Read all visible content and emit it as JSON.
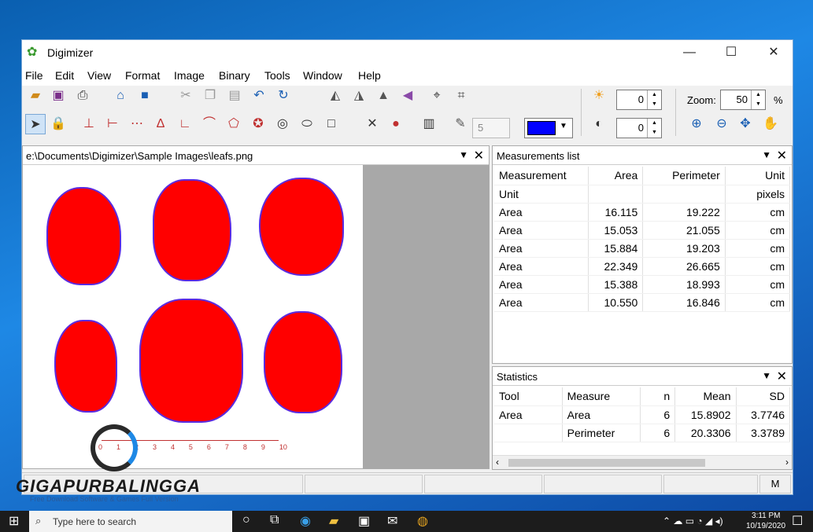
{
  "window": {
    "title": "Digimizer",
    "minimize": "—",
    "maximize": "☐",
    "close": "✕"
  },
  "menu": [
    "File",
    "Edit",
    "View",
    "Format",
    "Image",
    "Binary",
    "Tools",
    "Window",
    "Help"
  ],
  "toolbar": {
    "brightness_value": "0",
    "contrast_value": "0",
    "zoom_label": "Zoom:",
    "zoom_value": "50",
    "zoom_unit": "%",
    "point_value": "5",
    "color_swatch": "#0000ff",
    "icons_row1": [
      "open-icon",
      "save-icon",
      "print-icon",
      "scanner-icon",
      "camera-icon",
      "cut-icon",
      "copy-icon",
      "paste-icon",
      "undo-icon",
      "redo-icon",
      "rotate-left-icon",
      "rotate-right-icon",
      "flip-horizontal-icon",
      "flip-vertical-icon",
      "calibrate-icon",
      "crop-icon"
    ],
    "icons_row2": [
      "pointer-icon",
      "lock-icon",
      "marker-icon",
      "length-icon",
      "multi-length-icon",
      "angle-icon",
      "angle-90-icon",
      "polyline-icon",
      "polygon-icon",
      "shape-icon",
      "circle-icon",
      "ellipse-icon",
      "rectangle-icon",
      "delete-icon",
      "point-icon",
      "barcode-icon",
      "brush-icon"
    ]
  },
  "image_panel": {
    "path": "e:\\Documents\\Digimizer\\Sample Images\\leafs.png",
    "ruler_ticks": [
      "0",
      "1",
      "2",
      "3",
      "4",
      "5",
      "6",
      "7",
      "8",
      "9",
      "10"
    ]
  },
  "measurements": {
    "title": "Measurements list",
    "headers": [
      "Measurement",
      "Area",
      "Perimeter",
      "Unit"
    ],
    "unit_row": [
      "Unit",
      "",
      "",
      "pixels"
    ],
    "rows": [
      [
        "Area",
        "16.115",
        "19.222",
        "cm"
      ],
      [
        "Area",
        "15.053",
        "21.055",
        "cm"
      ],
      [
        "Area",
        "15.884",
        "19.203",
        "cm"
      ],
      [
        "Area",
        "22.349",
        "26.665",
        "cm"
      ],
      [
        "Area",
        "15.388",
        "18.993",
        "cm"
      ],
      [
        "Area",
        "10.550",
        "16.846",
        "cm"
      ]
    ]
  },
  "statistics": {
    "title": "Statistics",
    "headers": [
      "Tool",
      "Measure",
      "n",
      "Mean",
      "SD"
    ],
    "rows": [
      [
        "Area",
        "Area",
        "6",
        "15.8902",
        "3.7746"
      ],
      [
        "",
        "Perimeter",
        "6",
        "20.3306",
        "3.3789"
      ]
    ]
  },
  "status": {
    "mode": "M"
  },
  "taskbar": {
    "search_placeholder": "Type here to search",
    "time": "3:11 PM",
    "date": "10/19/2020"
  },
  "watermark": {
    "brand": "GIGAPURBALINGGA",
    "tagline": "Free Download Software & Games Full Version"
  }
}
